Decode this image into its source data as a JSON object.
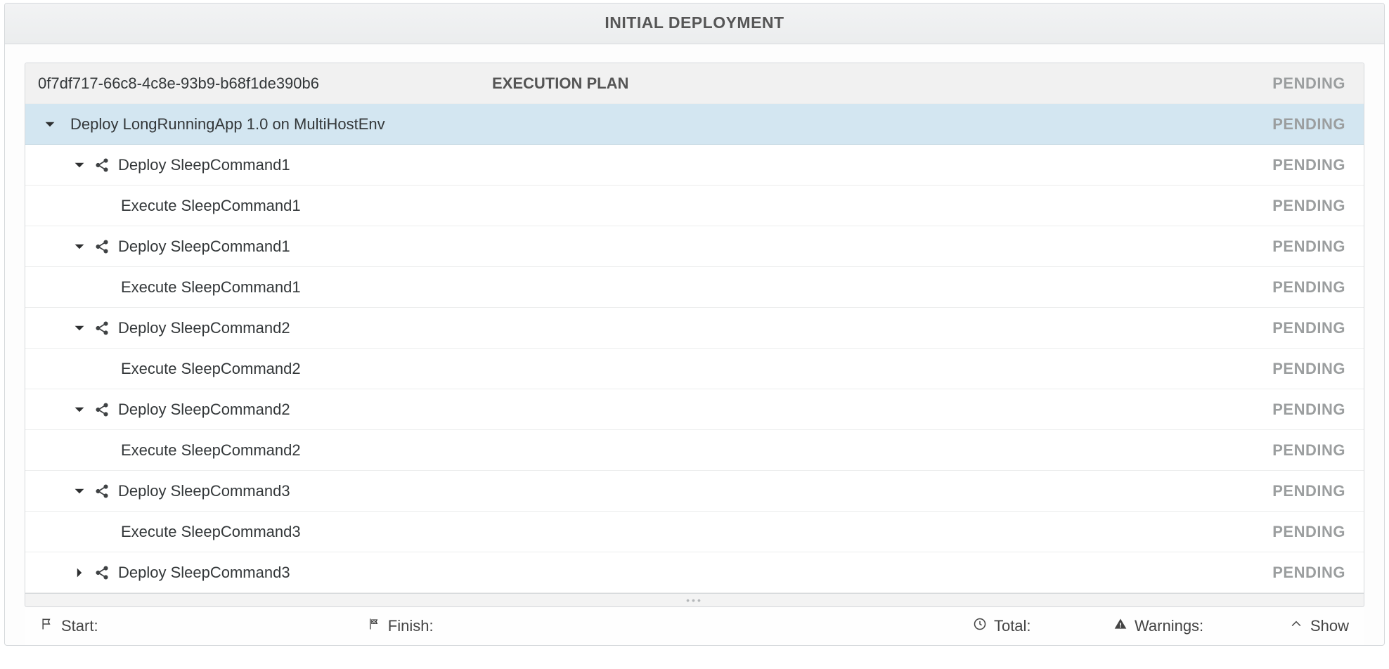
{
  "header": {
    "title": "INITIAL DEPLOYMENT"
  },
  "plan": {
    "id": "0f7df717-66c8-4c8e-93b9-b68f1de390b6",
    "center_label": "EXECUTION PLAN",
    "status": "PENDING"
  },
  "root": {
    "label": "Deploy LongRunningApp 1.0 on MultiHostEnv",
    "status": "PENDING"
  },
  "rows": [
    {
      "type": "group",
      "expanded": true,
      "label": "Deploy SleepCommand1",
      "status": "PENDING"
    },
    {
      "type": "leaf",
      "label": "Execute SleepCommand1",
      "status": "PENDING"
    },
    {
      "type": "group",
      "expanded": true,
      "label": "Deploy SleepCommand1",
      "status": "PENDING"
    },
    {
      "type": "leaf",
      "label": "Execute SleepCommand1",
      "status": "PENDING"
    },
    {
      "type": "group",
      "expanded": true,
      "label": "Deploy SleepCommand2",
      "status": "PENDING"
    },
    {
      "type": "leaf",
      "label": "Execute SleepCommand2",
      "status": "PENDING"
    },
    {
      "type": "group",
      "expanded": true,
      "label": "Deploy SleepCommand2",
      "status": "PENDING"
    },
    {
      "type": "leaf",
      "label": "Execute SleepCommand2",
      "status": "PENDING"
    },
    {
      "type": "group",
      "expanded": true,
      "label": "Deploy SleepCommand3",
      "status": "PENDING"
    },
    {
      "type": "leaf",
      "label": "Execute SleepCommand3",
      "status": "PENDING"
    },
    {
      "type": "group",
      "expanded": false,
      "label": "Deploy SleepCommand3",
      "status": "PENDING"
    }
  ],
  "footer": {
    "start_label": "Start:",
    "finish_label": "Finish:",
    "total_label": "Total:",
    "warnings_label": "Warnings:",
    "show_label": "Show"
  }
}
